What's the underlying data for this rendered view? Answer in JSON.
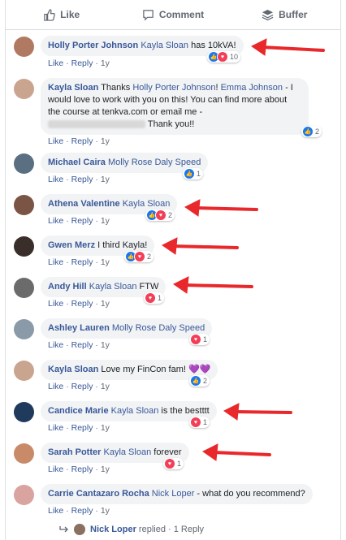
{
  "action_bar": {
    "like_label": "Like",
    "comment_label": "Comment",
    "buffer_label": "Buffer"
  },
  "meta": {
    "like": "Like",
    "reply": "Reply",
    "sep": "·",
    "time": "1y"
  },
  "comments": [
    {
      "author": "Holly Porter Johnson",
      "tag": "Kayla Sloan",
      "text": " has 10kVA!",
      "reactions": [
        "like",
        "love"
      ],
      "count": "10",
      "avatar_color": "#b07a62"
    },
    {
      "author": "Kayla Sloan",
      "text_pre": " Thanks ",
      "tag1": "Holly Porter Johnson",
      "text_mid": "! ",
      "tag2": "Emma Johnson",
      "text_body": " - I would love to work with you on this! You can find more about the course at ",
      "link": "tenkva.com",
      "text_tail": " or email me - ",
      "text_end": " Thank you!!",
      "reactions": [
        "like"
      ],
      "count": "2",
      "avatar_color": "#c9a590"
    },
    {
      "author": "Michael Caira",
      "tag": "Molly Rose Daly Speed",
      "text": "",
      "reactions": [
        "like"
      ],
      "count": "1",
      "avatar_color": "#5a6f82"
    },
    {
      "author": "Athena Valentine",
      "tag": "Kayla Sloan",
      "text": "",
      "reactions": [
        "like",
        "love"
      ],
      "count": "2",
      "avatar_color": "#7a5444"
    },
    {
      "author": "Gwen Merz",
      "tag": "",
      "text": " I third Kayla!",
      "reactions": [
        "like",
        "love"
      ],
      "count": "2",
      "avatar_color": "#3a2e2a"
    },
    {
      "author": "Andy Hill",
      "tag": "Kayla Sloan",
      "text": " FTW",
      "reactions": [
        "love"
      ],
      "count": "1",
      "avatar_color": "#6b6b6b"
    },
    {
      "author": "Ashley Lauren",
      "tag": "Molly Rose Daly Speed",
      "text": "",
      "reactions": [
        "love"
      ],
      "count": "1",
      "avatar_color": "#8a9aa8"
    },
    {
      "author": "Kayla Sloan",
      "tag": "",
      "text": " Love my FinCon fam! 💜💜",
      "reactions": [
        "like"
      ],
      "count": "2",
      "avatar_color": "#c9a590"
    },
    {
      "author": "Candice Marie",
      "tag": "Kayla Sloan",
      "text": " is the bestttt",
      "reactions": [
        "love"
      ],
      "count": "1",
      "avatar_color": "#1f3a5c"
    },
    {
      "author": "Sarah Potter",
      "tag": "Kayla Sloan",
      "text": " forever",
      "reactions": [
        "love"
      ],
      "count": "1",
      "avatar_color": "#c98a6a"
    },
    {
      "author": "Carrie Cantazaro Rocha",
      "tag": "Nick Loper",
      "text": " - what do you recommend?",
      "reactions": [],
      "count": "",
      "avatar_color": "#d9a3a0"
    }
  ],
  "reply_summary": {
    "author": "Nick Loper",
    "text": " replied · 1 Reply"
  },
  "colors": {
    "link_blue": "#385898",
    "arrow_red": "#e8282b",
    "bubble": "#f2f3f5"
  }
}
